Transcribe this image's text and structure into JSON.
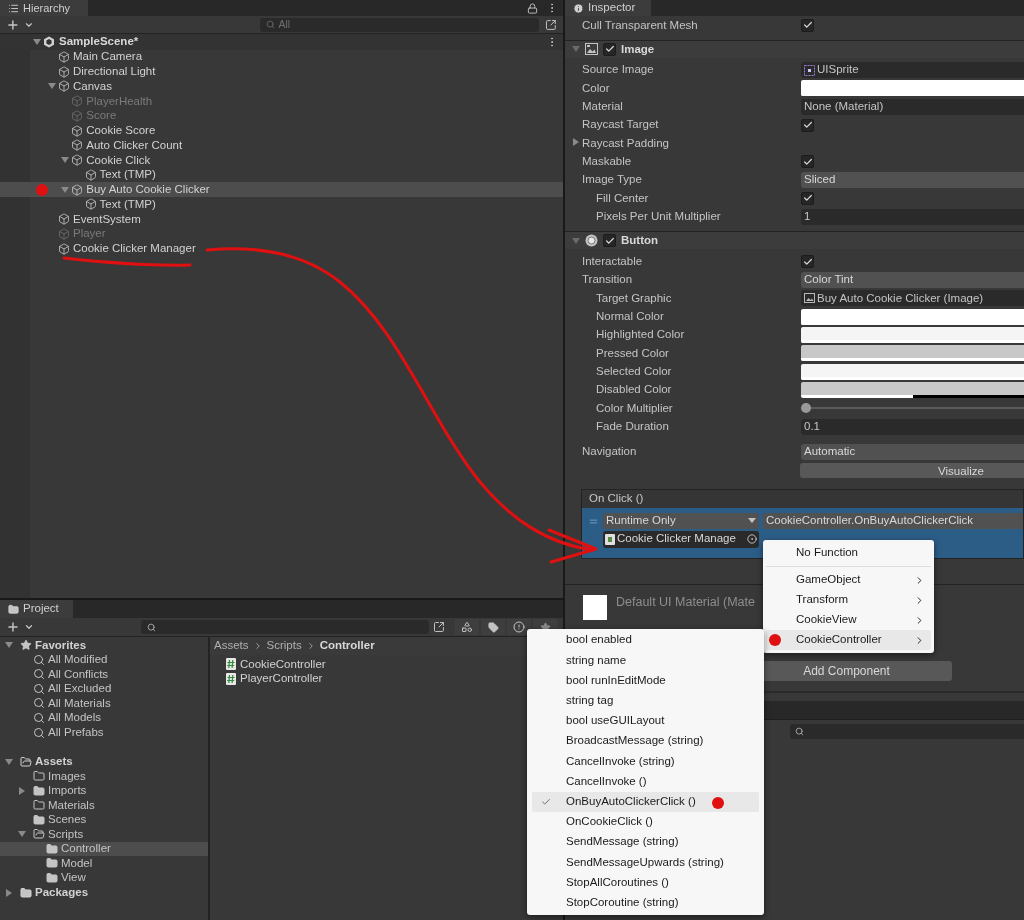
{
  "hierarchy": {
    "title": "Hierarchy",
    "search": {
      "placeholder": "All"
    },
    "scene": {
      "name": "SampleScene*",
      "expanded": true,
      "children": [
        {
          "name": "Main Camera",
          "disabled": false,
          "selected": false,
          "annotated": false
        },
        {
          "name": "Directional Light",
          "disabled": false,
          "selected": false,
          "annotated": false
        },
        {
          "name": "Canvas",
          "disabled": false,
          "selected": false,
          "annotated": false,
          "expanded": true,
          "children": [
            {
              "name": "PlayerHealth",
              "disabled": true,
              "selected": false,
              "annotated": false
            },
            {
              "name": "Score",
              "disabled": true,
              "selected": false,
              "annotated": false
            },
            {
              "name": "Cookie Score",
              "disabled": false,
              "selected": false,
              "annotated": false
            },
            {
              "name": "Auto Clicker Count",
              "disabled": false,
              "selected": false,
              "annotated": false
            },
            {
              "name": "Cookie Click",
              "disabled": false,
              "selected": false,
              "annotated": false,
              "expanded": true,
              "children": [
                {
                  "name": "Text (TMP)",
                  "disabled": false,
                  "selected": false,
                  "annotated": false
                }
              ]
            },
            {
              "name": "Buy Auto Cookie Clicker",
              "disabled": false,
              "selected": true,
              "annotated": true,
              "expanded": true,
              "children": [
                {
                  "name": "Text (TMP)",
                  "disabled": false,
                  "selected": false,
                  "annotated": false
                }
              ]
            }
          ]
        },
        {
          "name": "EventSystem",
          "disabled": false,
          "selected": false,
          "annotated": false
        },
        {
          "name": "Player",
          "disabled": true,
          "selected": false,
          "annotated": false
        },
        {
          "name": "Cookie Clicker Manager",
          "disabled": false,
          "selected": false,
          "annotated": false
        }
      ]
    }
  },
  "inspector": {
    "title": "Inspector",
    "top_rows": [
      {
        "label": "Cull Transparent Mesh",
        "kind": "checkbox",
        "checked": true
      }
    ],
    "components": [
      {
        "name": "Image",
        "kind": "image",
        "enabled": true,
        "expanded": true,
        "rows": [
          {
            "label": "Source Image",
            "kind": "sprite",
            "value": "UISprite"
          },
          {
            "label": "Color",
            "kind": "color",
            "color": "#ffffff",
            "level": 1
          },
          {
            "label": "Material",
            "kind": "object",
            "value": "None (Material)"
          },
          {
            "label": "Raycast Target",
            "kind": "checkbox",
            "checked": true
          },
          {
            "label": "Raycast Padding",
            "kind": "foldout",
            "expanded": false
          },
          {
            "label": "Maskable",
            "kind": "checkbox",
            "checked": true
          },
          {
            "label": "Image Type",
            "kind": "dropdown",
            "value": "Sliced",
            "children": [
              {
                "label": "Fill Center",
                "kind": "checkbox",
                "checked": true
              },
              {
                "label": "Pixels Per Unit Multiplier",
                "kind": "text",
                "value": "1"
              }
            ]
          }
        ]
      },
      {
        "name": "Button",
        "kind": "button",
        "enabled": true,
        "expanded": true,
        "rows": [
          {
            "label": "Interactable",
            "kind": "checkbox",
            "checked": true
          },
          {
            "label": "Transition",
            "kind": "dropdown",
            "value": "Color Tint",
            "children": [
              {
                "label": "Target Graphic",
                "kind": "imageref",
                "value": "Buy Auto Cookie Clicker (Image)"
              },
              {
                "label": "Normal Color",
                "kind": "color",
                "color": "#ffffff",
                "level": 1
              },
              {
                "label": "Highlighted Color",
                "kind": "color",
                "color": "#f5f5f5",
                "level": 1
              },
              {
                "label": "Pressed Color",
                "kind": "color",
                "color": "#c8c8c8",
                "level": 1
              },
              {
                "label": "Selected Color",
                "kind": "color",
                "color": "#f5f5f5",
                "level": 1
              },
              {
                "label": "Disabled Color",
                "kind": "color",
                "color": "#c8c8c8",
                "level": 0.5
              },
              {
                "label": "Color Multiplier",
                "kind": "slider",
                "level": 0
              },
              {
                "label": "Fade Duration",
                "kind": "text",
                "value": "0.1"
              }
            ]
          }
        ],
        "extra_rows": [
          {
            "label": "Navigation",
            "kind": "dropdown",
            "value": "Automatic"
          },
          {
            "kind": "button",
            "value": "Visualize"
          }
        ]
      }
    ],
    "on_click": {
      "title": "On Click ()",
      "mode": "Runtime Only",
      "function": "CookieController.OnBuyAutoClickerClick",
      "target": "Cookie Clicker Manage"
    },
    "material": {
      "name": "Default UI Material (Mate"
    },
    "add_component": "Add Component"
  },
  "function_menu": {
    "groups": [
      [
        {
          "label": "No Function",
          "submenu": false,
          "selected": false,
          "annotated": false
        }
      ],
      [
        {
          "label": "GameObject",
          "submenu": true,
          "selected": false,
          "annotated": false
        },
        {
          "label": "Transform",
          "submenu": true,
          "selected": false,
          "annotated": false
        },
        {
          "label": "CookieView",
          "submenu": true,
          "selected": false,
          "annotated": false
        },
        {
          "label": "CookieController",
          "submenu": true,
          "selected": true,
          "annotated": true
        }
      ]
    ]
  },
  "method_menu": {
    "items": [
      {
        "label": "bool enabled",
        "checked": false,
        "selected": false,
        "annotated": false
      },
      {
        "label": "string name",
        "checked": false,
        "selected": false,
        "annotated": false
      },
      {
        "label": "bool runInEditMode",
        "checked": false,
        "selected": false,
        "annotated": false
      },
      {
        "label": "string tag",
        "checked": false,
        "selected": false,
        "annotated": false
      },
      {
        "label": "bool useGUILayout",
        "checked": false,
        "selected": false,
        "annotated": false
      },
      {
        "label": "BroadcastMessage (string)",
        "checked": false,
        "selected": false,
        "annotated": false
      },
      {
        "label": "CancelInvoke (string)",
        "checked": false,
        "selected": false,
        "annotated": false
      },
      {
        "label": "CancelInvoke ()",
        "checked": false,
        "selected": false,
        "annotated": false
      },
      {
        "label": "OnBuyAutoClickerClick ()",
        "checked": true,
        "selected": true,
        "annotated": true
      },
      {
        "label": "OnCookieClick ()",
        "checked": false,
        "selected": false,
        "annotated": false
      },
      {
        "label": "SendMessage (string)",
        "checked": false,
        "selected": false,
        "annotated": false
      },
      {
        "label": "SendMessageUpwards (string)",
        "checked": false,
        "selected": false,
        "annotated": false
      },
      {
        "label": "StopAllCoroutines ()",
        "checked": false,
        "selected": false,
        "annotated": false
      },
      {
        "label": "StopCoroutine (string)",
        "checked": false,
        "selected": false,
        "annotated": false
      }
    ]
  },
  "project": {
    "title": "Project",
    "tree": [
      {
        "label": "Favorites",
        "kind": "favorites",
        "expanded": true,
        "selected": false,
        "children": [
          {
            "label": "All Modified",
            "kind": "filter",
            "selected": false
          },
          {
            "label": "All Conflicts",
            "kind": "filter",
            "selected": false
          },
          {
            "label": "All Excluded",
            "kind": "filter",
            "selected": false
          },
          {
            "label": "All Materials",
            "kind": "filter",
            "selected": false
          },
          {
            "label": "All Models",
            "kind": "filter",
            "selected": false
          },
          {
            "label": "All Prefabs",
            "kind": "filter",
            "selected": false
          }
        ]
      },
      {
        "label": "Assets",
        "kind": "folder",
        "expanded": true,
        "selected": false,
        "children": [
          {
            "label": "Images",
            "kind": "folder",
            "empty": true,
            "selected": false
          },
          {
            "label": "Imports",
            "kind": "folder",
            "empty": false,
            "expanded": false,
            "selected": false
          },
          {
            "label": "Materials",
            "kind": "folder",
            "empty": true,
            "selected": false
          },
          {
            "label": "Scenes",
            "kind": "folder",
            "empty": false,
            "selected": false
          },
          {
            "label": "Scripts",
            "kind": "folder",
            "expanded": true,
            "selected": false,
            "children": [
              {
                "label": "Controller",
                "kind": "folder",
                "empty": false,
                "selected": true
              },
              {
                "label": "Model",
                "kind": "folder",
                "empty": false,
                "selected": false
              },
              {
                "label": "View",
                "kind": "folder",
                "empty": false,
                "selected": false
              }
            ]
          }
        ]
      },
      {
        "label": "Packages",
        "kind": "folder",
        "empty": false,
        "expanded": false,
        "selected": false
      }
    ],
    "breadcrumb": [
      "Assets",
      "Scripts",
      "Controller"
    ],
    "files": [
      "CookieController",
      "PlayerController"
    ]
  }
}
